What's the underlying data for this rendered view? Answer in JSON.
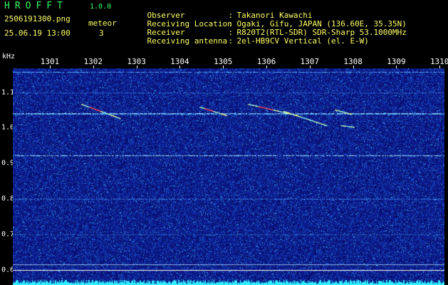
{
  "header": {
    "app_title": "HROFFT",
    "app_version": "1.0.0",
    "filename": "2506191300.png",
    "datetime": "25.06.19 13:00",
    "meteor_label": "meteor",
    "meteor_count": "3",
    "info": [
      {
        "key": "Observer",
        "sep": ":",
        "value": "Takanori Kawachi"
      },
      {
        "key": "Receiving Location",
        "sep": ":",
        "value": "Ogaki, Gifu, JAPAN (136.60E, 35.35N)"
      },
      {
        "key": "Receiver",
        "sep": ":",
        "value": "R820T2(RTL-SDR) SDR-Sharp 53.1000MHz"
      },
      {
        "key": "Receiving antenna",
        "sep": ":",
        "value": "2el-HB9CV Vertical (el. E-W)"
      }
    ]
  },
  "axes": {
    "y_unit": "kHz",
    "x_ticks": [
      "1301",
      "1302",
      "1303",
      "1304",
      "1305",
      "1306",
      "1307",
      "1308",
      "1309",
      "1310"
    ],
    "y_ticks": [
      "1.1",
      "1.0",
      "0.9",
      "0.8",
      "0.7",
      "0.6"
    ]
  },
  "colors": {
    "background": "#000000",
    "header_text": "#ffff66",
    "title_text": "#33ff66",
    "axis_text": "#ffffff",
    "spectrogram_base": "#0a1680"
  }
}
